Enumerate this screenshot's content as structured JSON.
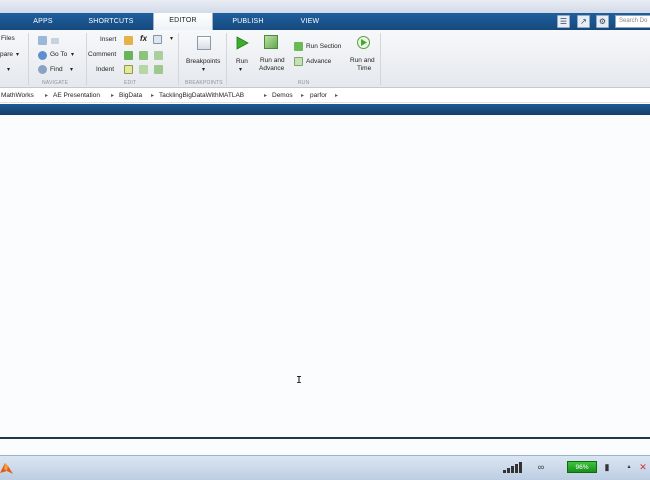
{
  "tabs": [
    {
      "label": "APPS",
      "active": false
    },
    {
      "label": "SHORTCUTS",
      "active": false
    },
    {
      "label": "EDITOR",
      "active": true
    },
    {
      "label": "PUBLISH",
      "active": false
    },
    {
      "label": "VIEW",
      "active": false
    }
  ],
  "search": {
    "placeholder": "Search Do"
  },
  "ribbon": {
    "file": {
      "files": "Files",
      "compare": "pare"
    },
    "navigate": {
      "go_to": "Go To",
      "find": "Find",
      "label": "NAVIGATE"
    },
    "edit": {
      "insert": "Insert",
      "comment": "Comment",
      "indent": "Indent",
      "label": "EDIT",
      "fx": "fx"
    },
    "breakpoints": {
      "button": "Breakpoints",
      "label": "BREAKPOINTS"
    },
    "run": {
      "run": "Run",
      "run_and_advance": [
        "Run and",
        "Advance"
      ],
      "run_section": "Run Section",
      "advance": "Advance",
      "run_and_time": [
        "Run and",
        "Time"
      ],
      "label": "RUN"
    }
  },
  "breadcrumb": [
    "MathWorks",
    "AE Presentation",
    "BigData",
    "TacklingBigDataWithMATLAB",
    "Demos",
    "parfor"
  ],
  "taskbar": {
    "battery": "96%"
  },
  "colors": {
    "ribbon_blue": "#1f5f9e",
    "editor_bg": "#fafcfd",
    "battery_green": "#2aa52a"
  }
}
